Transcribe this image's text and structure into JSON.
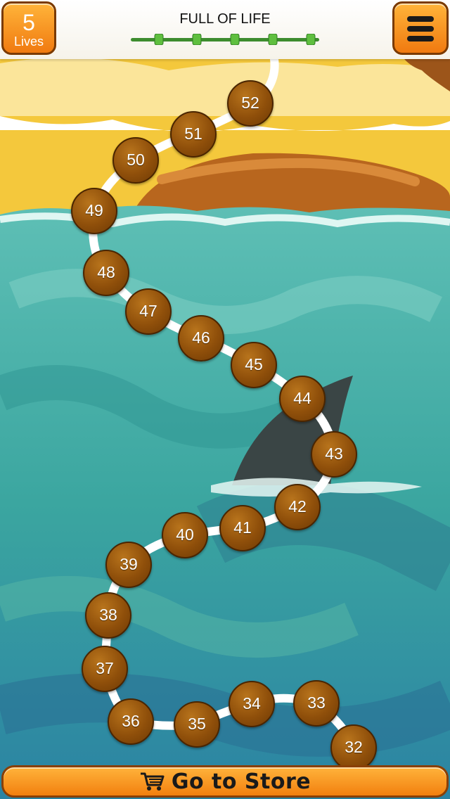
{
  "header": {
    "lives_count": "5",
    "lives_label": "Lives",
    "title": "FULL OF LIFE",
    "progress_segments": 5
  },
  "menu": {
    "icon": "hamburger-menu-icon"
  },
  "store": {
    "label": "Go to Store",
    "icon": "shopping-cart-icon"
  },
  "levels": [
    "32",
    "33",
    "34",
    "35",
    "36",
    "37",
    "38",
    "39",
    "40",
    "41",
    "42",
    "43",
    "44",
    "45",
    "46",
    "47",
    "48",
    "49",
    "50",
    "51",
    "52"
  ],
  "colors": {
    "button_orange": "#f5871a",
    "node_brown": "#8f4f0a",
    "sea": "#3aa7a0",
    "sand": "#f3c73a"
  }
}
